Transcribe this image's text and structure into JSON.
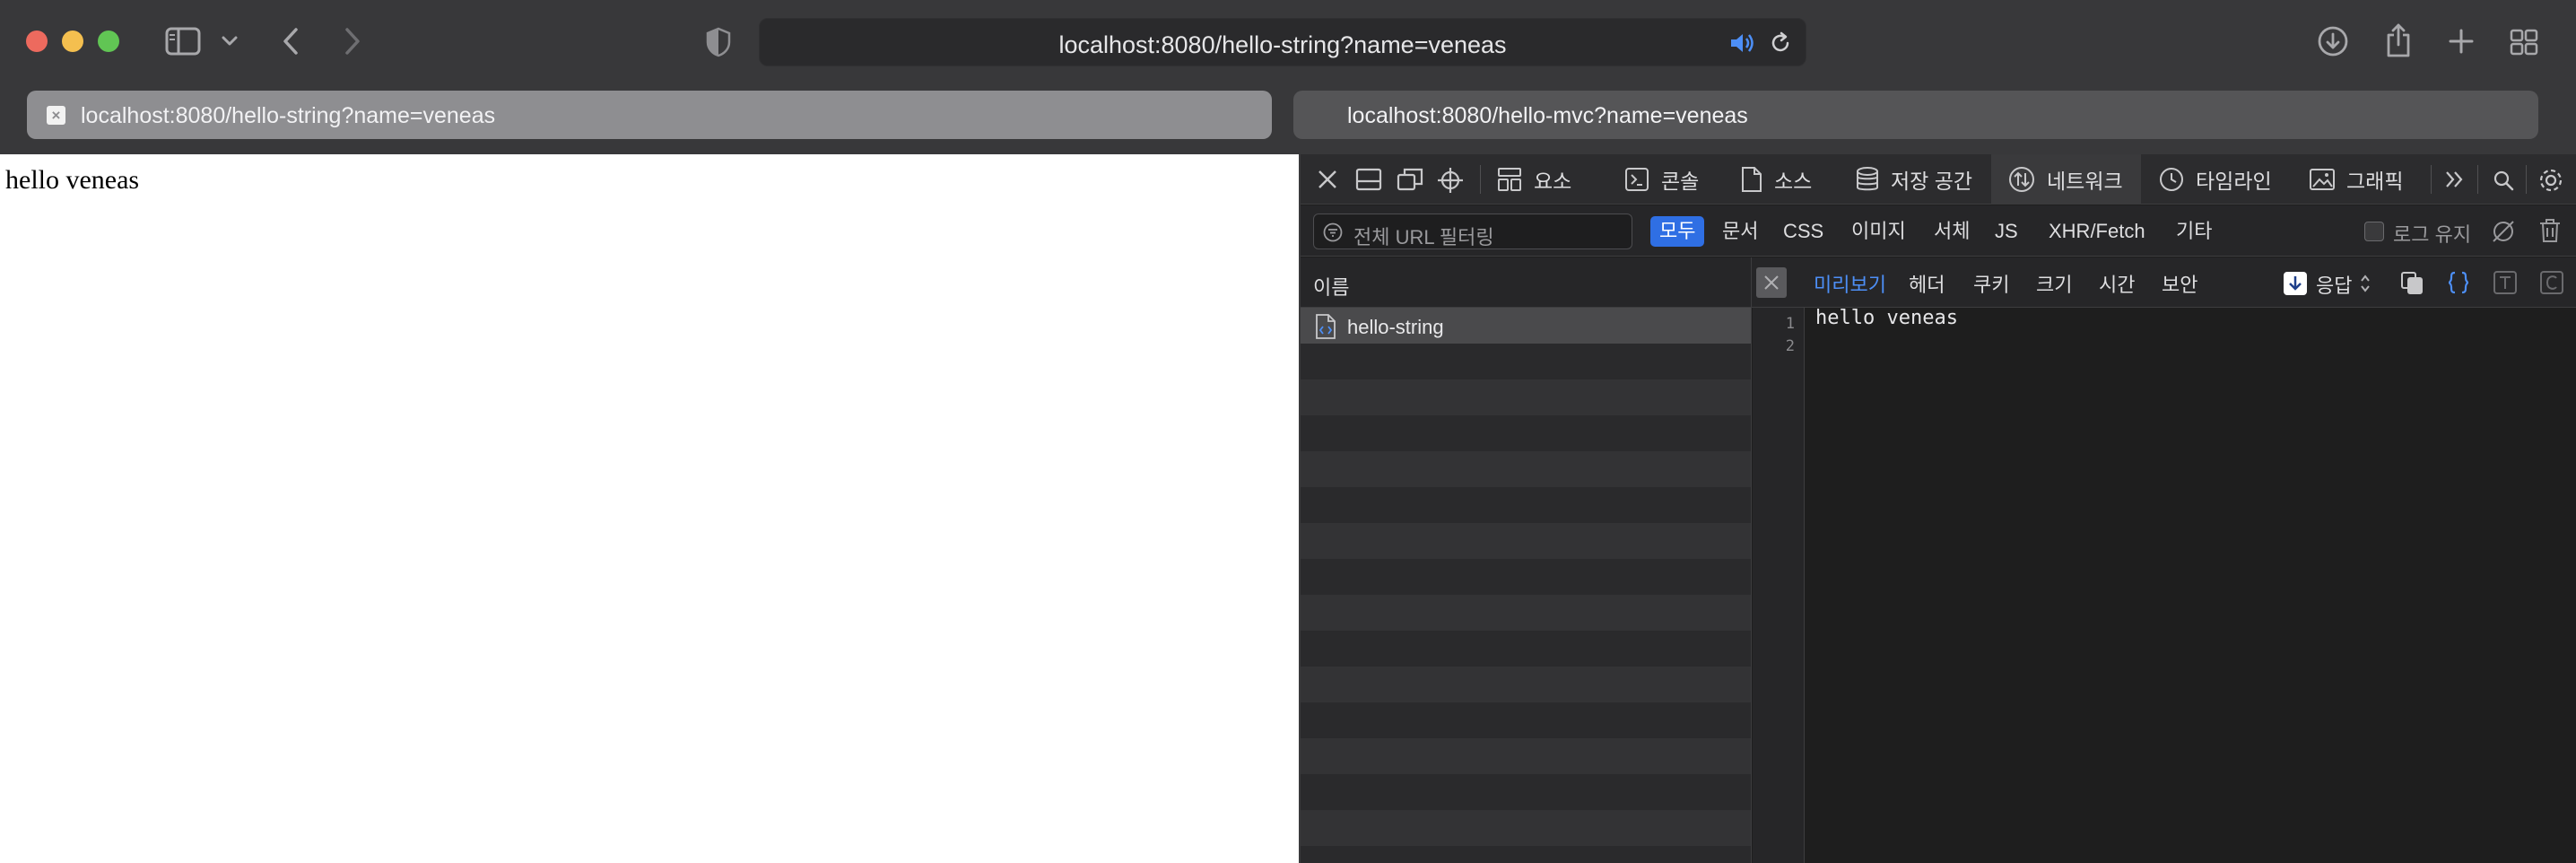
{
  "browser": {
    "url": "localhost:8080/hello-string?name=veneas",
    "tabs": [
      {
        "title": "localhost:8080/hello-string?name=veneas",
        "active": true
      },
      {
        "title": "localhost:8080/hello-mvc?name=veneas",
        "active": false
      }
    ]
  },
  "page": {
    "body_text": "hello veneas"
  },
  "devtools": {
    "tabs": [
      "요소",
      "콘솔",
      "소스",
      "저장 공간",
      "네트워크",
      "타임라인",
      "그래픽"
    ],
    "selected_tab": "네트워크",
    "filter": {
      "placeholder": "전체 URL 필터링",
      "types": [
        "모두",
        "문서",
        "CSS",
        "이미지",
        "서체",
        "JS",
        "XHR/Fetch",
        "기타"
      ],
      "active_type": "모두",
      "preserve_log_label": "로그 유지"
    },
    "request_list": {
      "column_name": "이름",
      "requests": [
        {
          "name": "hello-string",
          "type": "document"
        }
      ]
    },
    "detail": {
      "tabs": [
        "미리보기",
        "헤더",
        "쿠키",
        "크기",
        "시간",
        "보안"
      ],
      "active_tab": "미리보기",
      "source_select": "응답",
      "line_numbers": [
        "1",
        "2"
      ],
      "content": "hello veneas"
    }
  },
  "colors": {
    "accent": "#2f6fe4",
    "active_text": "#4d8ff7"
  }
}
